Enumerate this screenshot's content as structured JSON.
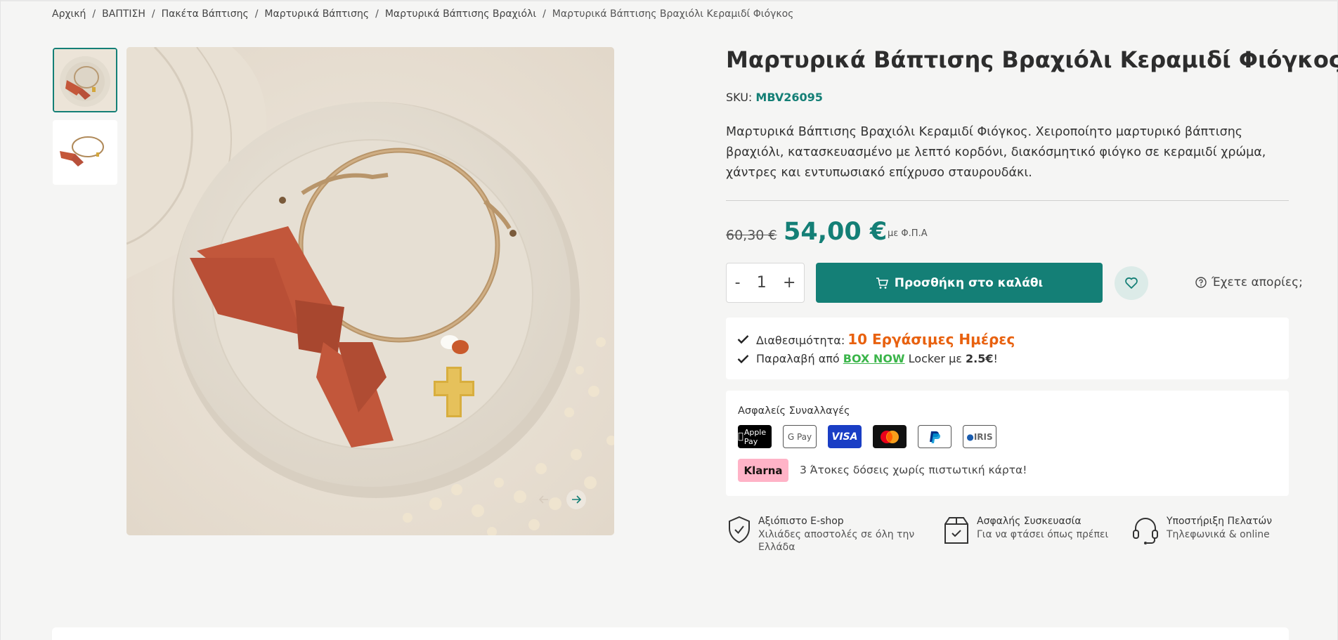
{
  "breadcrumb": {
    "items": [
      "Αρχική",
      "ΒΑΠΤΙΣΗ",
      "Πακέτα Βάπτισης",
      "Μαρτυρικά Βάπτισης",
      "Μαρτυρικά Βάπτισης Βραχιόλι"
    ],
    "separator": "/",
    "current": "Μαρτυρικά Βάπτισης Βραχιόλι Κεραμιδί Φιόγκος"
  },
  "product": {
    "title": "Μαρτυρικά Βάπτισης Βραχιόλι Κεραμιδί Φιόγκος",
    "sku_label": "SKU:",
    "sku": "MBV26095",
    "description": "Μαρτυρικά Βάπτισης Βραχιόλι Κεραμιδί Φιόγκος. Χειροποίητο μαρτυρικό βάπτισης βραχιόλι, κατασκευασμένο με λεπτό κορδόνι, διακόσμητικό φιόγκο σε κεραμιδί χρώμα, χάντρες και εντυπωσιακό επίχρυσο σταυρουδάκι.",
    "old_price": "60,30 €",
    "price": "54,00 €",
    "vat_note": "με Φ.Π.Α"
  },
  "cart": {
    "minus": "-",
    "quantity": "1",
    "plus": "+",
    "add_label": "Προσθήκη στο καλάθι",
    "question_label": "Έχετε απορίες;"
  },
  "availability": {
    "label": "Διαθεσιμότητα:",
    "value": "10 Εργάσιμες Ημέρες",
    "pickup_prefix": "Παραλαβή από",
    "pickup_link": "BOX NOW",
    "pickup_mid": "Locker με",
    "pickup_price": "2.5€",
    "pickup_suffix": "!"
  },
  "payments": {
    "title": "Ασφαλείς Συναλλαγές",
    "methods": [
      "Apple Pay",
      "G Pay",
      "VISA",
      "Mastercard",
      "PayPal",
      "IRIS"
    ],
    "klarna_label": "Klarna",
    "klarna_text": "3 Άτοκες δόσεις χωρίς πιστωτική κάρτα!"
  },
  "features": [
    {
      "title": "Αξιόπιστο E-shop",
      "desc_line1": "Χιλιάδες αποστολές σε όλη την",
      "desc_line2": "Ελλάδα",
      "icon": "shield-check-icon"
    },
    {
      "title": "Ασφαλής Συσκευασία",
      "desc_line1": "Για να φτάσει όπως πρέπει",
      "icon": "package-icon"
    },
    {
      "title": "Υποστήριξη Πελατών",
      "desc_line1": "Τηλεφωνικά & online",
      "icon": "headset-icon"
    }
  ],
  "colors": {
    "accent": "#147f76",
    "availability": "#e8610f",
    "boxnow": "#3bb54a",
    "klarna": "#ffb3c7",
    "background": "#f5f5f4"
  }
}
